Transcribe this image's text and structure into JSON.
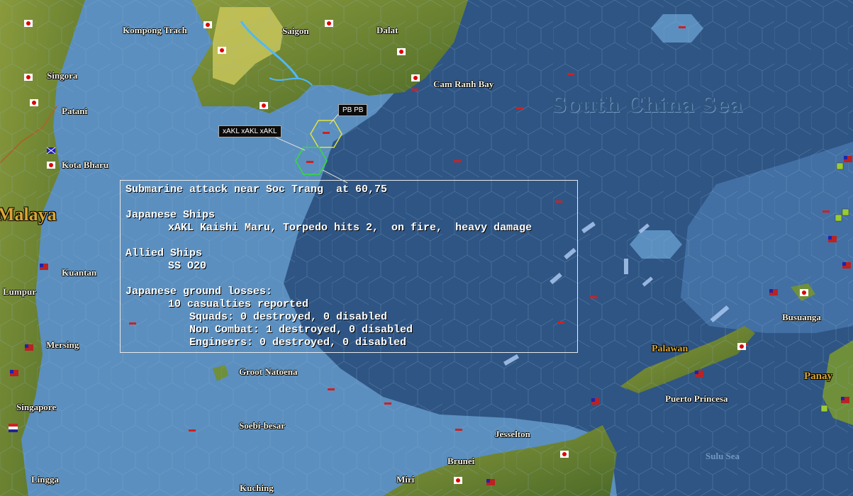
{
  "map": {
    "sea_name": "South China Sea",
    "regions": {
      "malaya": "Malaya",
      "palawan": "Palawan",
      "panay": "Panay"
    },
    "places": {
      "kompong_trach": "Kompong Trach",
      "saigon": "Saigon",
      "dalat": "Dalat",
      "singora": "Singora",
      "patani": "Patani",
      "cam_ranh_bay": "Cam Ranh Bay",
      "kota_bharu": "Kota Bharu",
      "kuantan": "Kuantan",
      "lumpur": "Lumpur",
      "mersing": "Mersing",
      "singapore": "Singapore",
      "lingga": "Lingga",
      "groot_natoena": "Groot Natoena",
      "soebi_besar": "Soebi-besar",
      "kuching": "Kuching",
      "miri": "Miri",
      "brunei": "Brunei",
      "jesselton": "Jesselton",
      "busuanga": "Busuanga",
      "puerto_princesa": "Puerto Princesa",
      "sulu_sea": "Sulu Sea"
    },
    "unit_tags": {
      "pb": "PB PB",
      "xakl": "xAKL xAKL xAKL"
    },
    "colors": {
      "deep_sea": "#2f5584",
      "shallow_sea": "#5b8fbf",
      "land": "#6f8f3a",
      "highlight_hex_yellow": "#e2e23a",
      "highlight_hex_green": "#33dd33"
    }
  },
  "report": {
    "title": "Submarine attack near Soc Trang  at 60,75",
    "japanese_ships_header": "Japanese Ships",
    "japanese_ship_line": "xAKL Kaishi Maru, Torpedo hits 2,  on fire,  heavy damage",
    "allied_ships_header": "Allied Ships",
    "allied_ship_line": "SS O20",
    "ground_losses_header": "Japanese ground losses:",
    "casualties_line": "10 casualties reported",
    "squads_line": "Squads: 0 destroyed, 0 disabled",
    "non_combat_line": "Non Combat: 1 destroyed, 0 disabled",
    "engineers_line": "Engineers: 0 destroyed, 0 disabled"
  }
}
